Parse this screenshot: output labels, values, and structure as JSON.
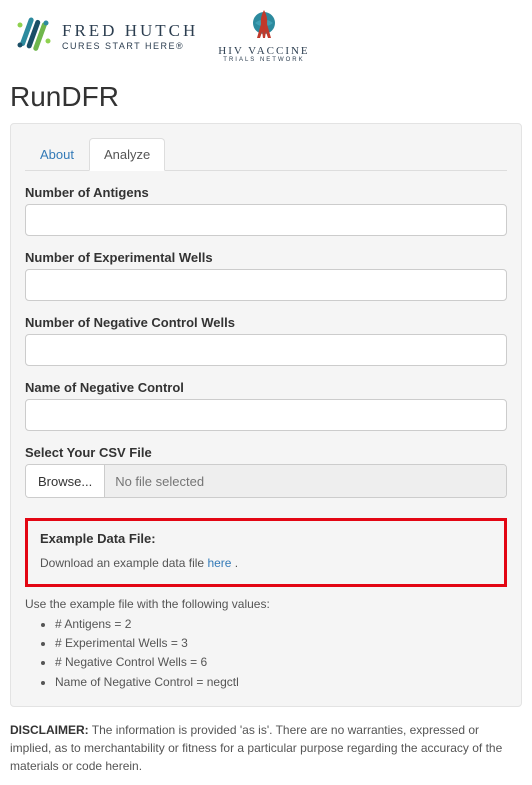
{
  "header": {
    "fred_hutch_title": "FRED HUTCH",
    "fred_hutch_sub": "CURES START HERE®",
    "hvtn_title": "HIV VACCINE",
    "hvtn_sub": "TRIALS NETWORK"
  },
  "page_title": "RunDFR",
  "tabs": {
    "about": "About",
    "analyze": "Analyze"
  },
  "form": {
    "num_antigens": {
      "label": "Number of Antigens",
      "value": ""
    },
    "num_exp_wells": {
      "label": "Number of Experimental Wells",
      "value": ""
    },
    "num_neg_wells": {
      "label": "Number of Negative Control Wells",
      "value": ""
    },
    "neg_name": {
      "label": "Name of Negative Control",
      "value": ""
    },
    "csv": {
      "label": "Select Your CSV File",
      "browse": "Browse...",
      "placeholder": "No file selected"
    }
  },
  "example": {
    "title": "Example Data File:",
    "prefix": "Download an example data file ",
    "link": "here",
    "suffix": " .",
    "usage": "Use the example file with the following values:",
    "vals": [
      "# Antigens = 2",
      "# Experimental Wells = 3",
      "# Negative Control Wells = 6",
      "Name of Negative Control = negctl"
    ]
  },
  "disclaimer": {
    "label": "DISCLAIMER:",
    "text": " The information is provided 'as is'. There are no warranties, expressed or implied, as to merchantability or fitness for a particular purpose regarding the accuracy of the materials or code herein."
  }
}
